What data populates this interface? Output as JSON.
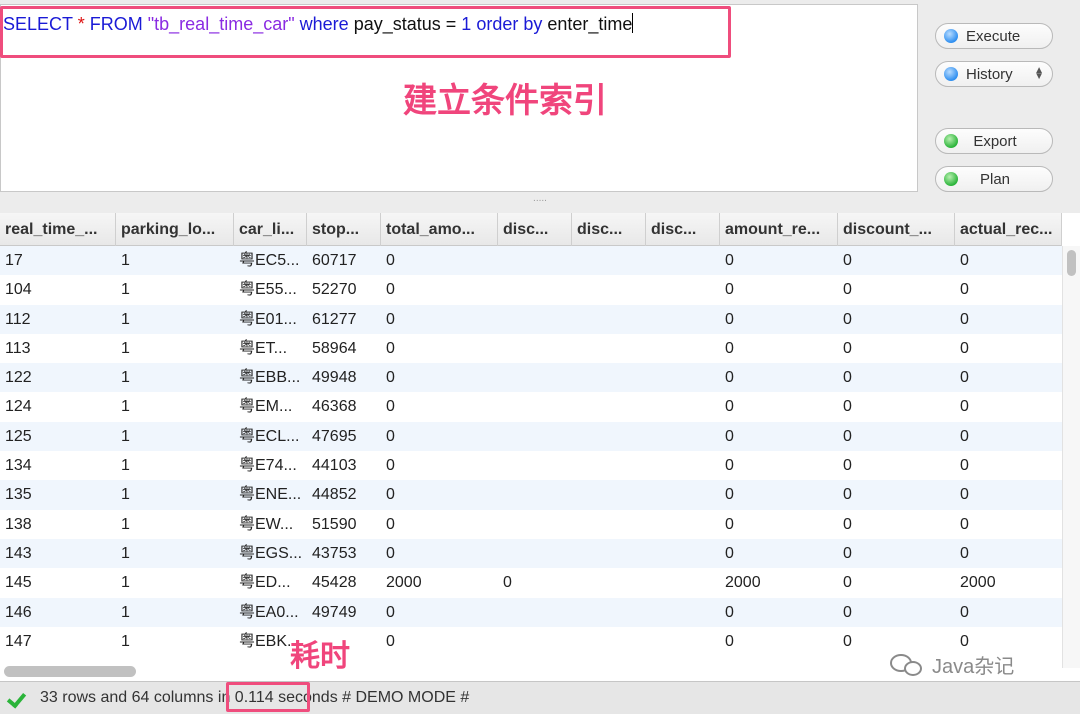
{
  "editor": {
    "sql": {
      "t1": "SELECT",
      "t2": "*",
      "t3": "FROM",
      "t4": "\"tb_real_time_car\"",
      "t5": "where",
      "t6": "pay_status =",
      "t7": "1",
      "t8": "order by",
      "t9": "enter_time"
    },
    "annotation": "建立条件索引"
  },
  "buttons": {
    "execute": "Execute",
    "history": "History",
    "export": "Export",
    "plan": "Plan"
  },
  "splitter": ".....",
  "grid": {
    "columns": [
      "real_time_...",
      "parking_lo...",
      "car_li...",
      "stop...",
      "total_amo...",
      "disc...",
      "disc...",
      "disc...",
      "amount_re...",
      "discount_...",
      "actual_rec..."
    ],
    "rows": [
      [
        "17",
        "1",
        "粤EC5...",
        "60717",
        "0",
        "",
        "",
        "",
        "0",
        "0",
        "0"
      ],
      [
        "104",
        "1",
        "粤E55...",
        "52270",
        "0",
        "",
        "",
        "",
        "0",
        "0",
        "0"
      ],
      [
        "112",
        "1",
        "粤E01...",
        "61277",
        "0",
        "",
        "",
        "",
        "0",
        "0",
        "0"
      ],
      [
        "113",
        "1",
        "粤ET...",
        "58964",
        "0",
        "",
        "",
        "",
        "0",
        "0",
        "0"
      ],
      [
        "122",
        "1",
        "粤EBB...",
        "49948",
        "0",
        "",
        "",
        "",
        "0",
        "0",
        "0"
      ],
      [
        "124",
        "1",
        "粤EM...",
        "46368",
        "0",
        "",
        "",
        "",
        "0",
        "0",
        "0"
      ],
      [
        "125",
        "1",
        "粤ECL...",
        "47695",
        "0",
        "",
        "",
        "",
        "0",
        "0",
        "0"
      ],
      [
        "134",
        "1",
        "粤E74...",
        "44103",
        "0",
        "",
        "",
        "",
        "0",
        "0",
        "0"
      ],
      [
        "135",
        "1",
        "粤ENE...",
        "44852",
        "0",
        "",
        "",
        "",
        "0",
        "0",
        "0"
      ],
      [
        "138",
        "1",
        "粤EW...",
        "51590",
        "0",
        "",
        "",
        "",
        "0",
        "0",
        "0"
      ],
      [
        "143",
        "1",
        "粤EGS...",
        "43753",
        "0",
        "",
        "",
        "",
        "0",
        "0",
        "0"
      ],
      [
        "145",
        "1",
        "粤ED...",
        "45428",
        "2000",
        "0",
        "",
        "",
        "2000",
        "0",
        "2000"
      ],
      [
        "146",
        "1",
        "粤EA0...",
        "49749",
        "0",
        "",
        "",
        "",
        "0",
        "0",
        "0"
      ],
      [
        "147",
        "1",
        "粤EBK...",
        "",
        "0",
        "",
        "",
        "",
        "0",
        "0",
        "0"
      ]
    ],
    "time_annotation": "耗时"
  },
  "status": {
    "prefix": "33 rows and 64 columns",
    "time": "in 0.114",
    "suffix": "seconds # DEMO MODE #"
  },
  "watermark": "Java杂记",
  "colors": {
    "highlight": "#ef4d7d",
    "keyword": "#1a1ad6",
    "string": "#8a2be2"
  }
}
